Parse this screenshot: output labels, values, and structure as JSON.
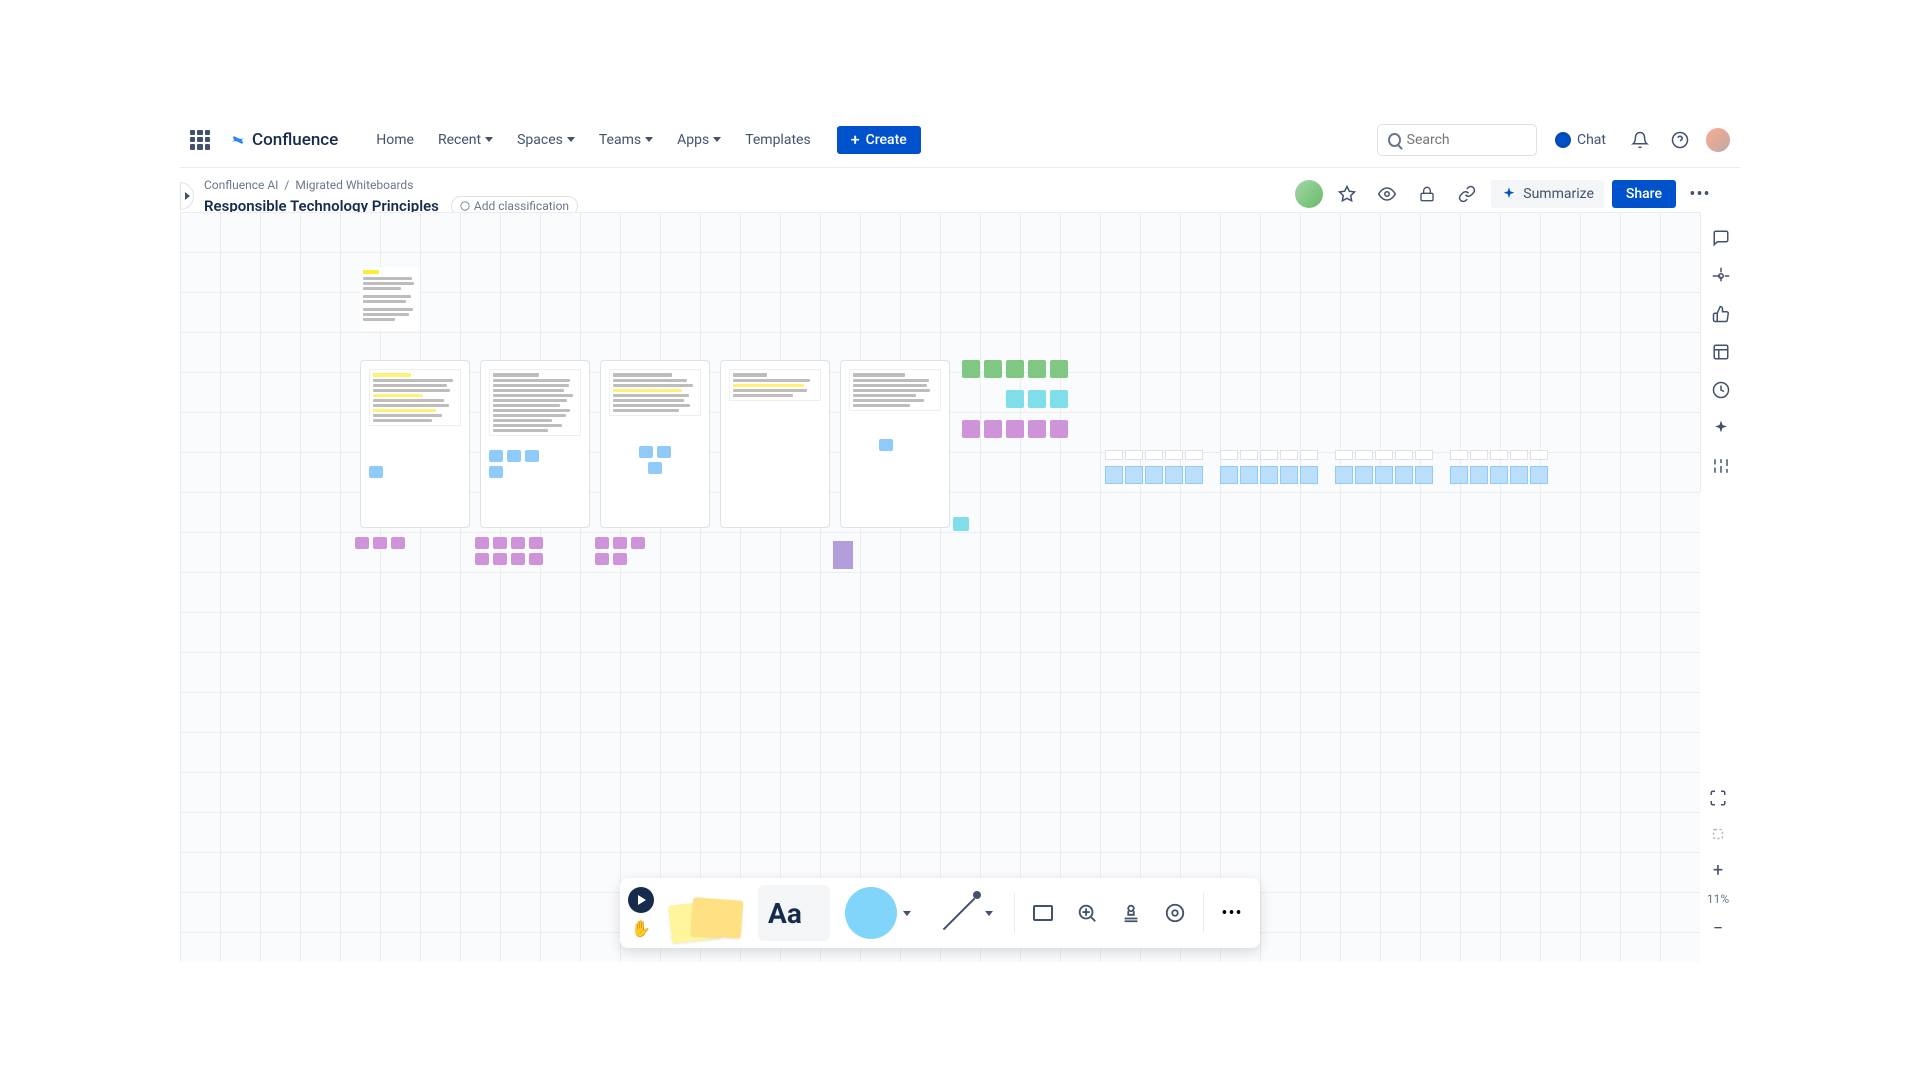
{
  "brand": "Confluence",
  "nav": {
    "home": "Home",
    "recent": "Recent",
    "spaces": "Spaces",
    "teams": "Teams",
    "apps": "Apps",
    "templates": "Templates",
    "create": "Create"
  },
  "search": {
    "placeholder": "Search"
  },
  "chat": {
    "label": "Chat"
  },
  "breadcrumb": {
    "space": "Confluence AI",
    "parent": "Migrated Whiteboards",
    "sep": "/"
  },
  "page": {
    "title": "Responsible Technology Principles",
    "classification": "Add classification"
  },
  "actions": {
    "summarize": "Summarize",
    "share": "Share"
  },
  "zoom": {
    "level": "11%"
  },
  "toolbar": {
    "text_label": "Aa"
  },
  "colors": {
    "primary": "#0052cc",
    "sticky_yellow": "#ffe082",
    "sticky_green": "#a5d6a7",
    "sticky_teal": "#80deea",
    "sticky_purple": "#ce93d8",
    "sticky_blue": "#90caf9",
    "shape_blue": "#81d4fa"
  }
}
